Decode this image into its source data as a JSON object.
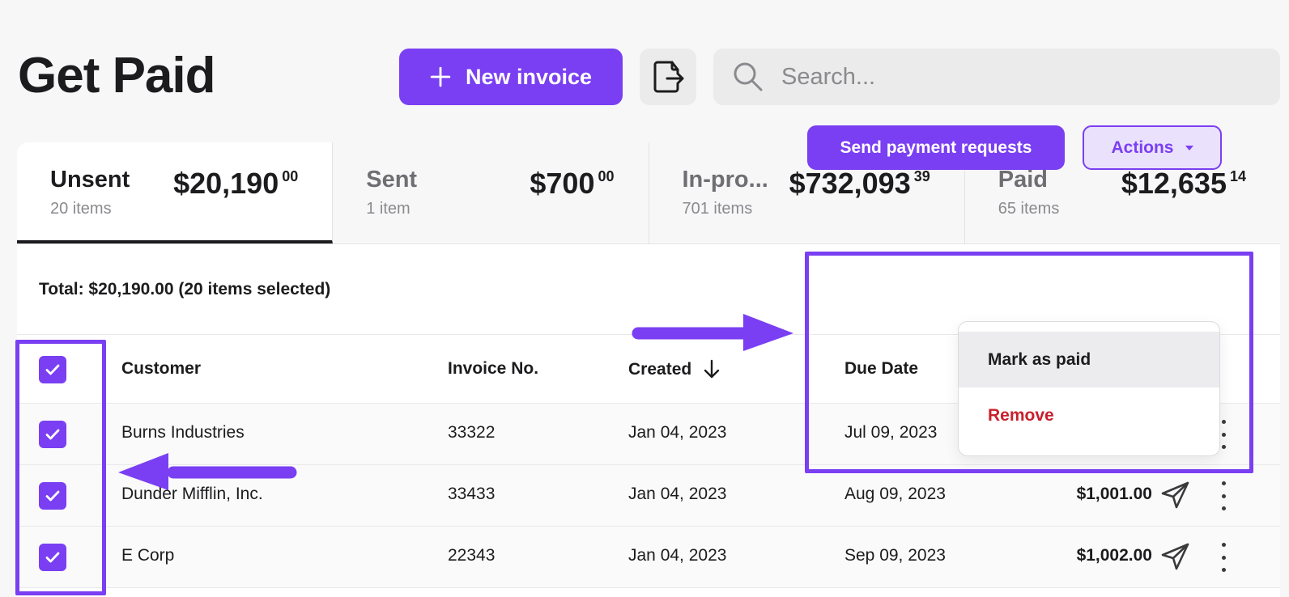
{
  "header": {
    "title": "Get Paid",
    "new_invoice_label": "New invoice",
    "search_placeholder": "Search..."
  },
  "tabs": [
    {
      "name": "Unsent",
      "count": "20 items",
      "amount": "$20,190",
      "cents": "00",
      "active": true
    },
    {
      "name": "Sent",
      "count": "1 item",
      "amount": "$700",
      "cents": "00",
      "active": false
    },
    {
      "name": "In-pro...",
      "count": "701 items",
      "amount": "$732,093",
      "cents": "39",
      "active": false
    },
    {
      "name": "Paid",
      "count": "65 items",
      "amount": "$12,635",
      "cents": "14",
      "active": false
    }
  ],
  "toolbar": {
    "total_text": "Total: $20,190.00 (20 items selected)",
    "send_label": "Send payment requests",
    "actions_label": "Actions"
  },
  "actions_menu": [
    {
      "label": "Mark as paid",
      "style": "hover"
    },
    {
      "label": "Remove",
      "style": "danger"
    }
  ],
  "table": {
    "columns": [
      "Customer",
      "Invoice No.",
      "Created",
      "Due Date"
    ],
    "sort_column": "Created",
    "rows": [
      {
        "customer": "Burns Industries",
        "invoice_no": "33322",
        "created": "Jan 04, 2023",
        "due": "Jul 09, 2023",
        "amount": "",
        "checked": true
      },
      {
        "customer": "Dunder Mifflin, Inc.",
        "invoice_no": "33433",
        "created": "Jan 04, 2023",
        "due": "Aug 09, 2023",
        "amount": "$1,001.00",
        "checked": true
      },
      {
        "customer": "E Corp",
        "invoice_no": "22343",
        "created": "Jan 04, 2023",
        "due": "Sep 09, 2023",
        "amount": "$1,002.00",
        "checked": true
      }
    ]
  },
  "colors": {
    "accent": "#7a3ff2",
    "accent_light": "#eae1fd",
    "danger": "#c8202c"
  }
}
